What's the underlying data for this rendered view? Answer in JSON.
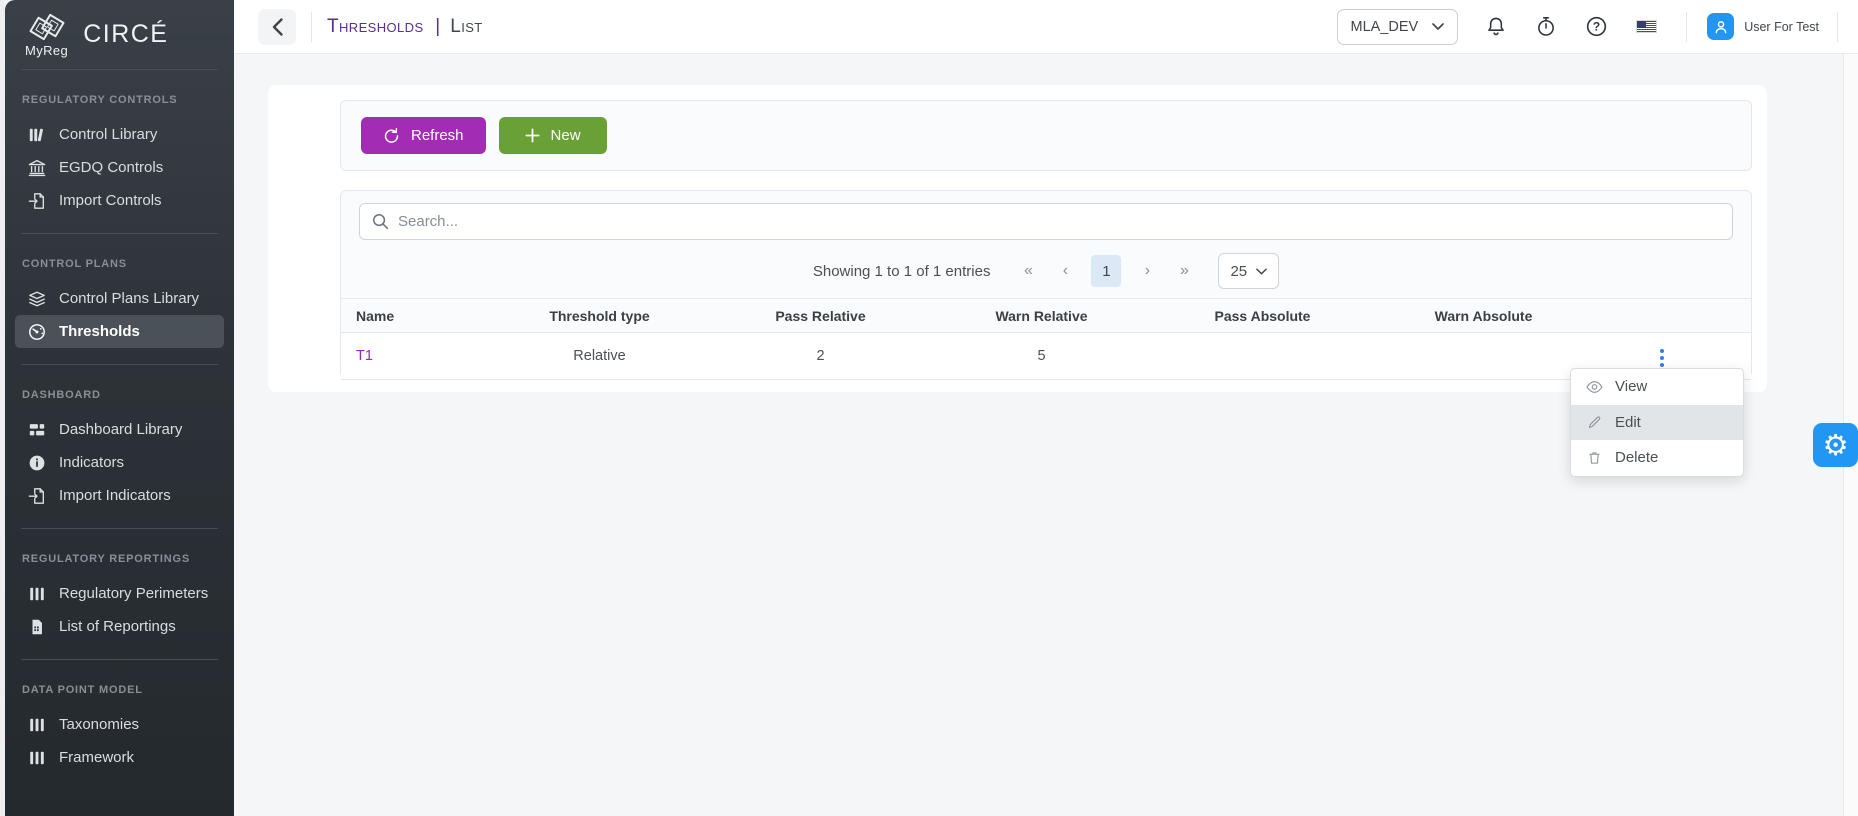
{
  "brand": {
    "logo_text": "MyReg",
    "app_name": "CIRCÉ"
  },
  "sidebar": {
    "sections": [
      {
        "label": "Regulatory Controls",
        "items": [
          {
            "label": "Control Library",
            "icon": "library-books-icon"
          },
          {
            "label": "EGDQ Controls",
            "icon": "bank-icon"
          },
          {
            "label": "Import Controls",
            "icon": "import-file-icon"
          }
        ]
      },
      {
        "label": "Control Plans",
        "items": [
          {
            "label": "Control Plans Library",
            "icon": "layers-icon"
          },
          {
            "label": "Thresholds",
            "icon": "gauge-icon",
            "active": true
          }
        ]
      },
      {
        "label": "Dashboard",
        "items": [
          {
            "label": "Dashboard Library",
            "icon": "dashboard-grid-icon"
          },
          {
            "label": "Indicators",
            "icon": "info-circle-icon"
          },
          {
            "label": "Import Indicators",
            "icon": "import-file-icon"
          }
        ]
      },
      {
        "label": "Regulatory Reportings",
        "items": [
          {
            "label": "Regulatory Perimeters",
            "icon": "books-icon"
          },
          {
            "label": "List of Reportings",
            "icon": "report-file-icon"
          }
        ]
      },
      {
        "label": "Data Point Model",
        "items": [
          {
            "label": "Taxonomies",
            "icon": "books-icon"
          },
          {
            "label": "Framework",
            "icon": "books-icon"
          }
        ]
      }
    ]
  },
  "header": {
    "breadcrumb_primary": "Thresholds",
    "breadcrumb_separator": "|",
    "breadcrumb_secondary": "List",
    "environment": "MLA_DEV",
    "user_name": "User For Test"
  },
  "toolbar": {
    "refresh_label": "Refresh",
    "new_label": "New"
  },
  "search": {
    "placeholder": "Search..."
  },
  "pagination": {
    "summary": "Showing 1 to 1 of 1 entries",
    "first": "«",
    "prev": "‹",
    "page": "1",
    "next": "›",
    "last": "»",
    "page_size": "25"
  },
  "table": {
    "columns": [
      "Name",
      "Threshold type",
      "Pass Relative",
      "Warn Relative",
      "Pass Absolute",
      "Warn Absolute"
    ],
    "rows": [
      {
        "name": "T1",
        "threshold_type": "Relative",
        "pass_relative": "2",
        "warn_relative": "5",
        "pass_absolute": "",
        "warn_absolute": ""
      }
    ]
  },
  "context_menu": {
    "view": "View",
    "edit": "Edit",
    "delete": "Delete"
  },
  "colors": {
    "accent_purple": "#a32cb5",
    "accent_green": "#6aa137",
    "accent_blue": "#2196f3",
    "breadcrumb_purple": "#5b2d90",
    "link_purple": "#9c27b0",
    "sidebar_dark": "#2c3237",
    "page_bg": "#f4f6f8"
  }
}
